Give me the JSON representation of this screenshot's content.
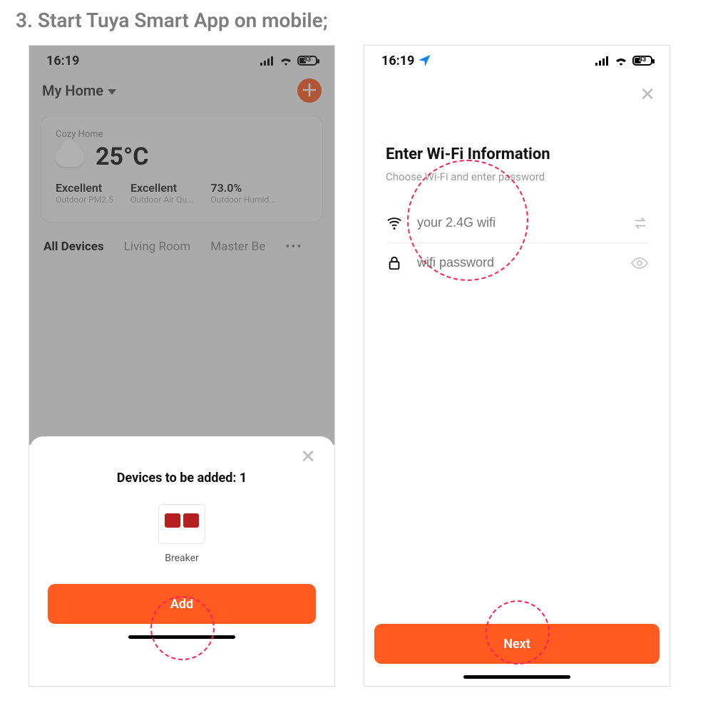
{
  "instruction": "3. Start Tuya Smart App on mobile;",
  "statusbar": {
    "time": "16:19",
    "battery_label": "33"
  },
  "screenA": {
    "home_label": "My Home",
    "card": {
      "room": "Cozy Home",
      "temperature": "25°C",
      "stats": [
        {
          "value": "Excellent",
          "label": "Outdoor PM2.5"
        },
        {
          "value": "Excellent",
          "label": "Outdoor Air Qu..."
        },
        {
          "value": "73.0%",
          "label": "Outdoor Humid..."
        }
      ]
    },
    "tabs": {
      "active": "All Devices",
      "t2": "Living Room",
      "t3_truncated": "Master Be",
      "more": "•••"
    },
    "sheet": {
      "title": "Devices to be added: 1",
      "device_name": "Breaker",
      "button": "Add"
    }
  },
  "screenB": {
    "title": "Enter Wi-Fi Information",
    "subtitle": "Choose Wi-Fi and enter password",
    "wifi_placeholder": "your 2.4G wifi",
    "password_placeholder": "wifi password",
    "button": "Next"
  }
}
